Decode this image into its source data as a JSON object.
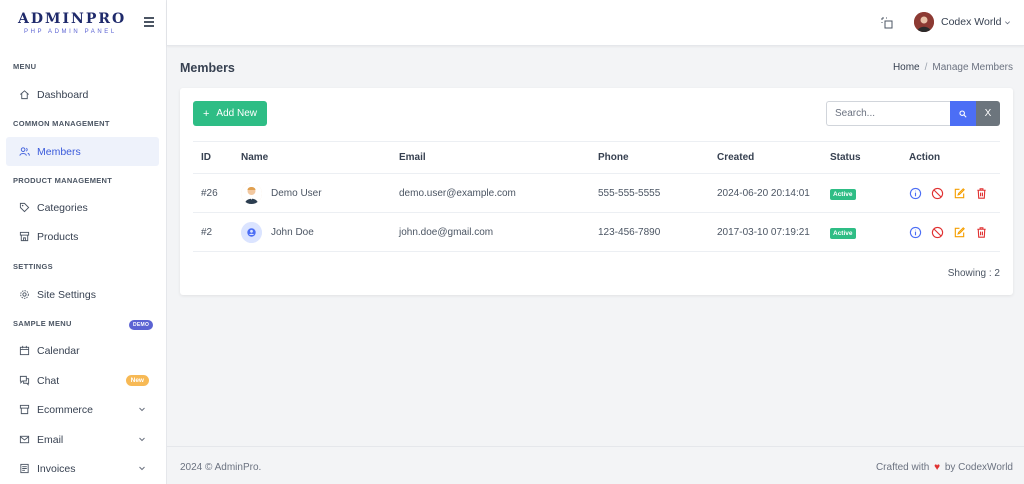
{
  "brand": {
    "title": "ADMINPRO",
    "subtitle": "PHP ADMIN PANEL"
  },
  "sidebar": {
    "sections": [
      {
        "heading": "MENU"
      },
      {
        "heading": "COMMON MANAGEMENT"
      },
      {
        "heading": "PRODUCT MANAGEMENT"
      },
      {
        "heading": "SETTINGS"
      },
      {
        "heading": "SAMPLE MENU",
        "badge": "DEMO"
      }
    ],
    "items": [
      {
        "label": "Dashboard",
        "icon": "home-icon"
      },
      {
        "label": "Members",
        "icon": "users-icon",
        "active": true
      },
      {
        "label": "Categories",
        "icon": "tag-icon"
      },
      {
        "label": "Products",
        "icon": "store-icon"
      },
      {
        "label": "Site Settings",
        "icon": "gear-icon"
      },
      {
        "label": "Calendar",
        "icon": "calendar-icon"
      },
      {
        "label": "Chat",
        "icon": "chat-icon",
        "badge": "New"
      },
      {
        "label": "Ecommerce",
        "icon": "shop-icon",
        "expandable": true
      },
      {
        "label": "Email",
        "icon": "mail-icon",
        "expandable": true
      },
      {
        "label": "Invoices",
        "icon": "invoice-icon",
        "expandable": true
      }
    ]
  },
  "topbar": {
    "user_name": "Codex World"
  },
  "page": {
    "title": "Members",
    "breadcrumb": {
      "home": "Home",
      "current": "Manage Members"
    }
  },
  "toolbar": {
    "add_label": "Add New",
    "search_placeholder": "Search...",
    "clear_label": "X"
  },
  "table": {
    "headers": {
      "id": "ID",
      "name": "Name",
      "email": "Email",
      "phone": "Phone",
      "created": "Created",
      "status": "Status",
      "action": "Action"
    },
    "rows": [
      {
        "id": "#26",
        "name": "Demo User",
        "email": "demo.user@example.com",
        "phone": "555-555-5555",
        "created": "2024-06-20 20:14:01",
        "status": "Active"
      },
      {
        "id": "#2",
        "name": "John Doe",
        "email": "john.doe@gmail.com",
        "phone": "123-456-7890",
        "created": "2017-03-10 07:19:21",
        "status": "Active"
      }
    ],
    "showing": "Showing : 2"
  },
  "footer": {
    "copyright": "2024 © AdminPro.",
    "crafted_prefix": "Crafted with",
    "crafted_suffix": "by CodexWorld"
  },
  "colors": {
    "accent": "#3b5bdb",
    "success": "#2ebd85",
    "danger": "#e03131",
    "warning": "#f59f00",
    "info": "#4c6ef5"
  }
}
